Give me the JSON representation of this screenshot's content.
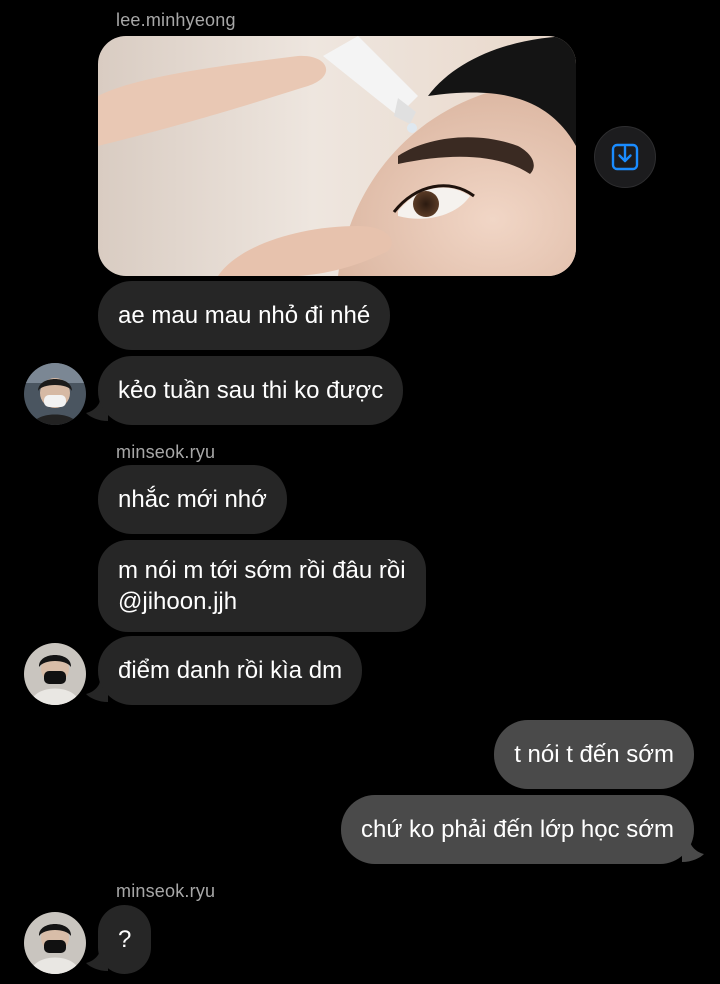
{
  "colors": {
    "background": "#000000",
    "incoming_bubble": "#262626",
    "outgoing_bubble": "#4a4a4a",
    "sender_label": "#a8a8a8",
    "save_icon": "#1a8cff"
  },
  "groups": [
    {
      "sender": "lee.minhyeong",
      "attachment": {
        "type": "image",
        "save_icon": "download-icon"
      },
      "messages": [
        "ae mau mau nhỏ đi nhé",
        "kẻo tuần sau thi ko được"
      ]
    },
    {
      "sender": "minseok.ryu",
      "messages": [
        "nhắc mới nhớ",
        "m nói m tới sớm rồi đâu rồi",
        "@jihoon.jjh",
        "điểm danh rồi kìa dm"
      ]
    },
    {
      "sender": "me",
      "messages": [
        "t nói t đến sớm",
        "chứ ko phải đến lớp học sớm"
      ]
    },
    {
      "sender": "minseok.ryu",
      "messages": [
        "?"
      ]
    }
  ]
}
